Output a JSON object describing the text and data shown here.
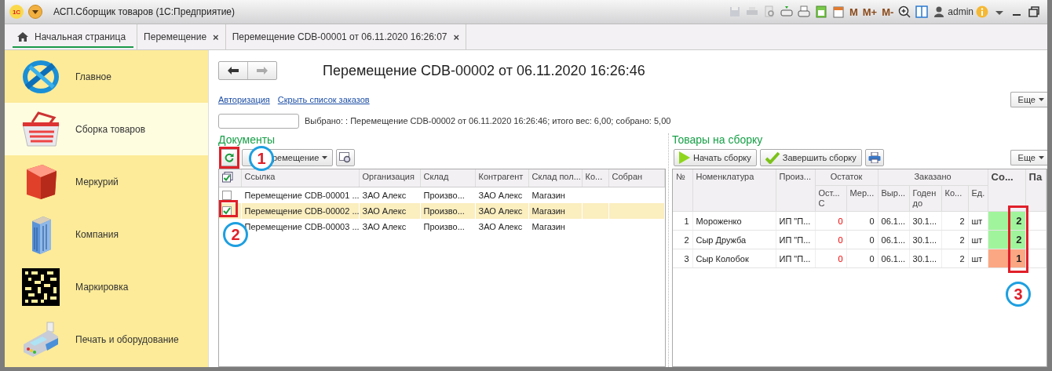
{
  "window": {
    "logo": "1С",
    "title": "АСП.Сборщик товаров  (1С:Предприятие)",
    "memory_buttons": [
      "M",
      "M+",
      "M-"
    ],
    "user": "admin"
  },
  "tabs": [
    {
      "label": "Начальная страница",
      "kind": "home",
      "selected": true
    },
    {
      "label": "Перемещение",
      "kind": "closable",
      "close": "×",
      "selected": false
    },
    {
      "label": "Перемещение CDB-00001 от 06.11.2020 16:26:07",
      "kind": "closable",
      "close": "×",
      "selected": false
    }
  ],
  "sidebar": {
    "items": [
      {
        "label": "Главное",
        "kind": "orbit",
        "selected": false
      },
      {
        "label": "Сборка товаров",
        "kind": "basket",
        "selected": true
      },
      {
        "label": "Меркурий",
        "kind": "cube",
        "selected": false
      },
      {
        "label": "Компания",
        "kind": "building",
        "selected": false
      },
      {
        "label": "Маркировка",
        "kind": "code",
        "selected": false
      },
      {
        "label": "Печать и оборудование",
        "kind": "terminal",
        "selected": false
      }
    ]
  },
  "form": {
    "title": "Перемещение CDB-00002 от 06.11.2020 16:26:46",
    "links": [
      "Авторизация",
      "Скрыть список заказов"
    ],
    "more_button": "Еще",
    "selection_text": "Выбрано: : Перемещение CDB-00002 от 06.11.2020 16:26:46; итого вес: 6,00; собрано: 5,00"
  },
  "documents": {
    "title": "Документы",
    "filter_button": "ремещение",
    "columns": [
      "Ссылка",
      "Организация",
      "Склад",
      "Контрагент",
      "Склад пол...",
      "Ко...",
      "Собран"
    ],
    "rows": [
      {
        "checked": false,
        "selected": false,
        "cells": [
          "Перемещение CDB-00001 ...",
          "ЗАО Алекс",
          "Произво...",
          "ЗАО Алекс",
          "Магазин"
        ]
      },
      {
        "checked": true,
        "selected": true,
        "cells": [
          "Перемещение CDB-00002 ...",
          "ЗАО Алекс",
          "Произво...",
          "ЗАО Алекс",
          "Магазин"
        ]
      },
      {
        "selected": false,
        "cells": [
          "Перемещение CDB-00003 ...",
          "ЗАО Алекс",
          "Произво...",
          "ЗАО Алекс",
          "Магазин"
        ]
      }
    ]
  },
  "goods": {
    "title": "Товары на сборку",
    "buttons": [
      "Начать сборку",
      "Завершить сборку"
    ],
    "more_button": "Еще",
    "columns": [
      {
        "label": "№"
      },
      {
        "label": "Номенклатура"
      },
      {
        "label": "Произ..."
      },
      {
        "label": "Остаток",
        "colspan": 2,
        "children": [
          {
            "label": "Ост... С"
          },
          {
            "label": "Мер..."
          }
        ]
      },
      {
        "label": "Заказано",
        "colspan": 4,
        "children": [
          {
            "label": "Выр..."
          },
          {
            "label": "Годен до"
          },
          {
            "label": "Ко..."
          },
          {
            "label": "Ед."
          }
        ]
      },
      {
        "label": "Со..."
      },
      {
        "label": "Па"
      }
    ],
    "rows": [
      {
        "cells": [
          "1",
          "Мороженко",
          "ИП \"П...",
          "0",
          "0",
          "06.1...",
          "30.1...",
          "2",
          "шт"
        ],
        "collected": "2",
        "color": "#a0f59c"
      },
      {
        "cells": [
          "2",
          "Сыр Дружба",
          "ИП \"П...",
          "0",
          "0",
          "06.1...",
          "30.1...",
          "2",
          "шт"
        ],
        "collected": "2",
        "color": "#a0f59c"
      },
      {
        "cells": [
          "3",
          "Сыр Колобок",
          "ИП \"П...",
          "0",
          "0",
          "06.1...",
          "30.1...",
          "2",
          "шт"
        ],
        "collected": "1",
        "color": "#fca783"
      }
    ]
  },
  "annotations": [
    {
      "label": "1"
    },
    {
      "label": "2"
    },
    {
      "label": "3"
    }
  ]
}
